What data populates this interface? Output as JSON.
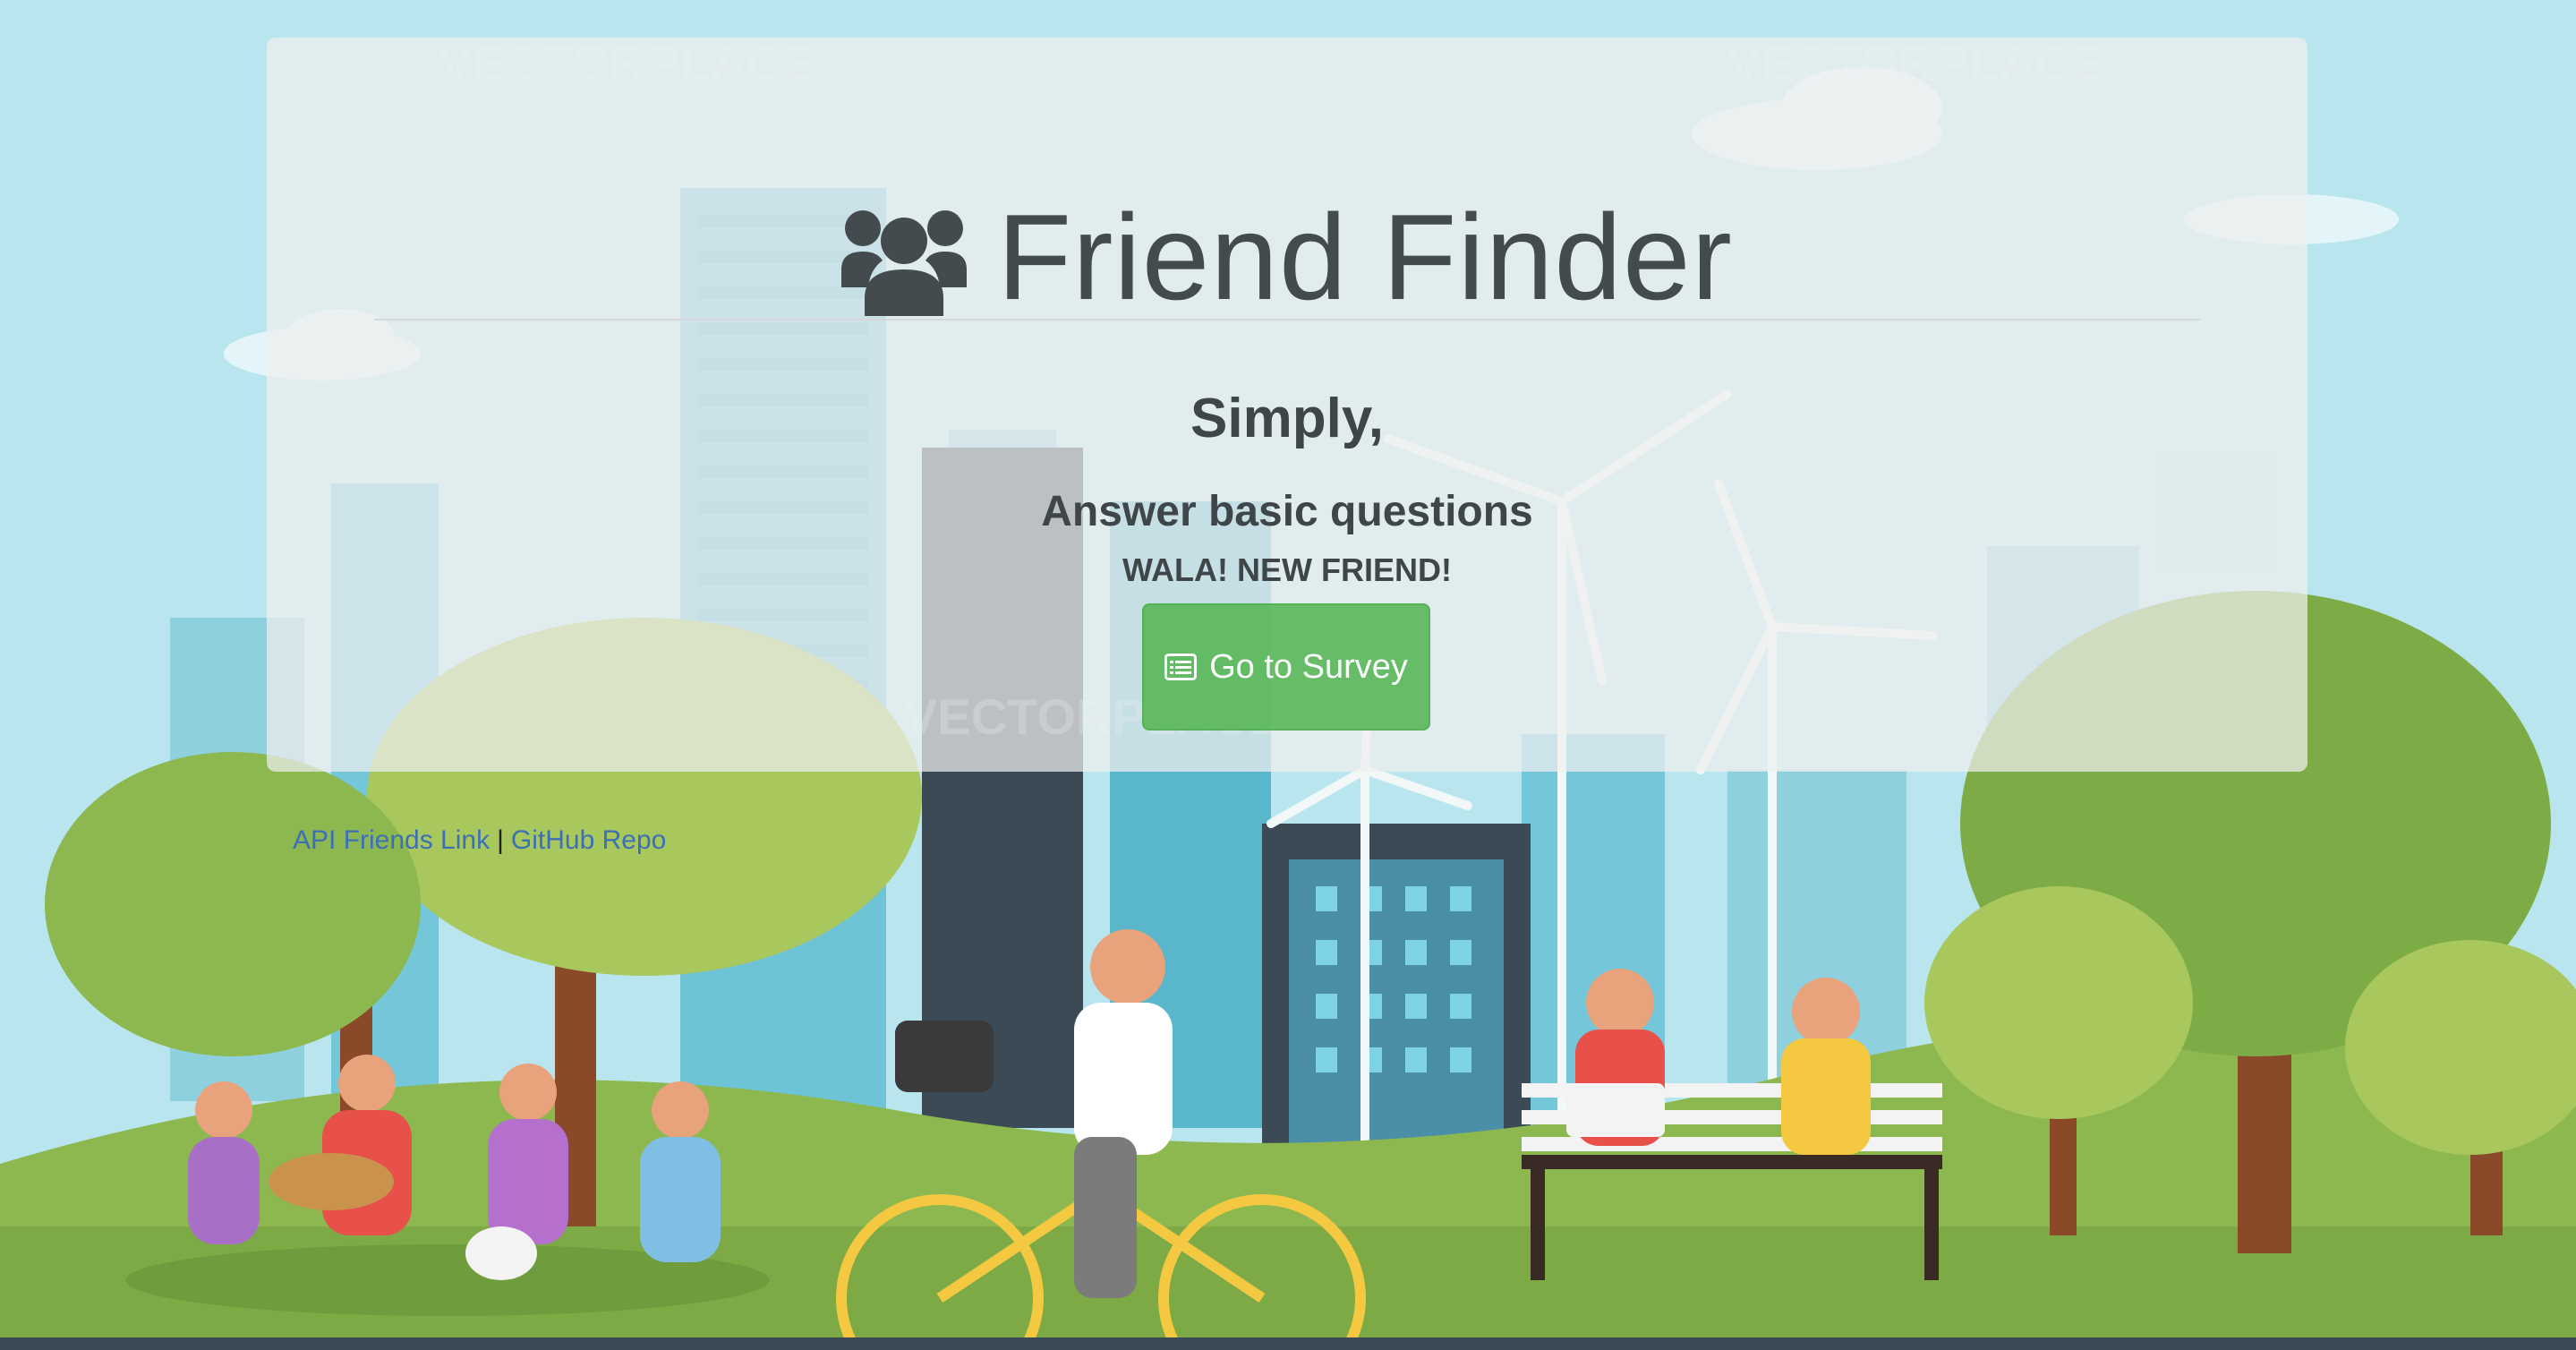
{
  "header": {
    "icon": "users-icon",
    "title": "Friend Finder"
  },
  "main": {
    "line1": "Simply,",
    "line2": "Answer basic questions",
    "line3": "WALA! NEW FRIEND!",
    "survey_button": {
      "icon": "list-alt-icon",
      "label": "Go to Survey"
    }
  },
  "footer": {
    "api_link": "API Friends Link",
    "separator": "|",
    "github_link": "GitHub Repo"
  },
  "background": {
    "description_icons": [
      "city-skyline",
      "wind-turbine",
      "trees",
      "people-in-park",
      "cyclist",
      "bench"
    ],
    "watermark": "VECTORPLACE"
  },
  "colors": {
    "sky": "#b9e6ee",
    "grass": "#7daa45",
    "button": "#5cb85c",
    "link": "#3d6fb6",
    "text": "#444b4f"
  }
}
